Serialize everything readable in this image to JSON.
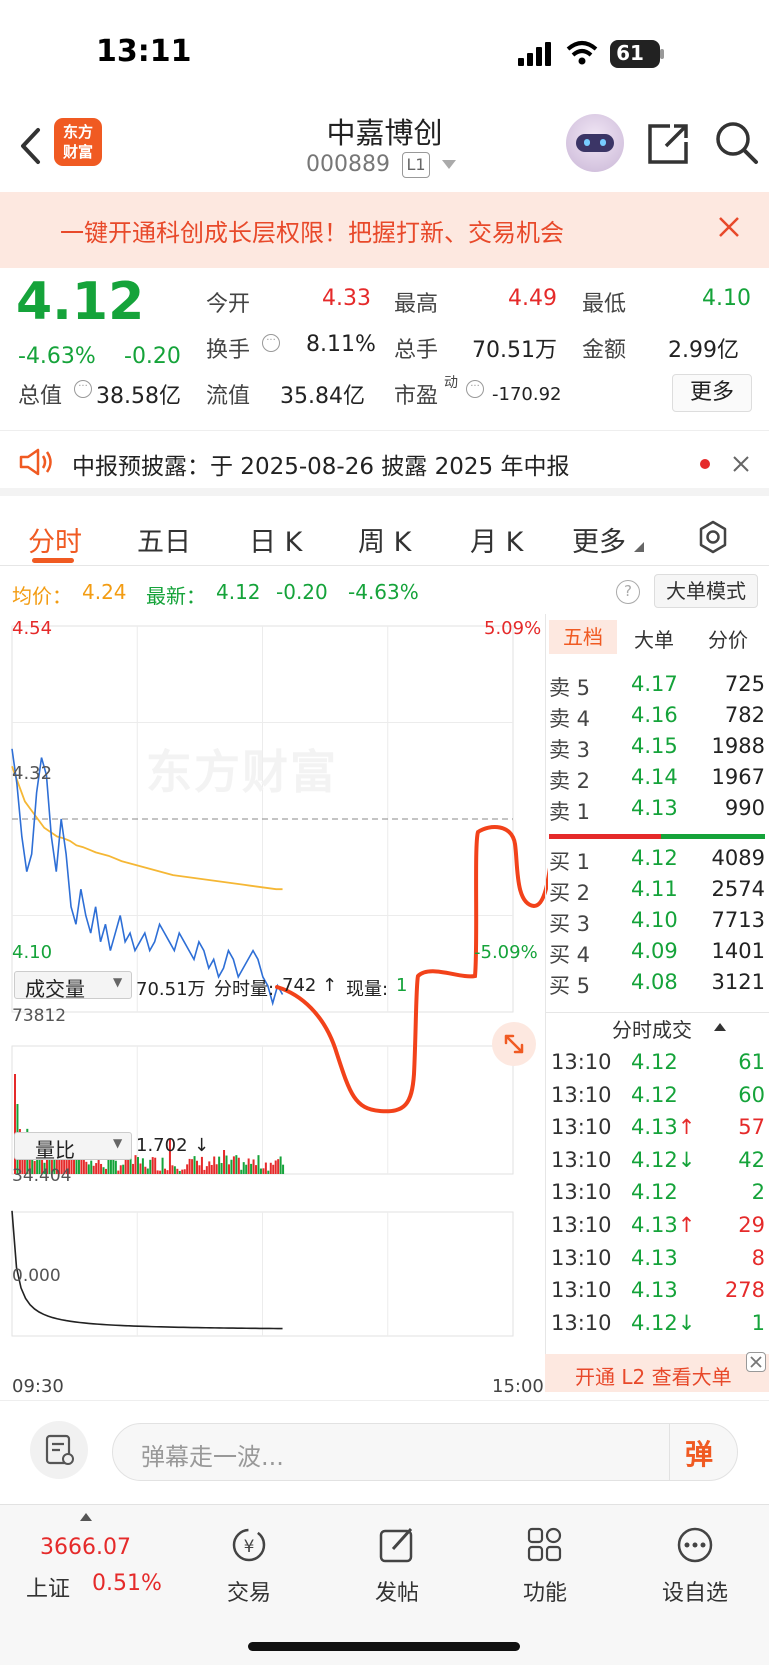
{
  "status": {
    "time": "13:11",
    "battery": "61"
  },
  "nav": {
    "logo_line1": "东方",
    "logo_line2": "财富",
    "title": "中嘉博创",
    "code": "000889",
    "level": "L1"
  },
  "banner": {
    "text": "一键开通科创成长层权限！把握打新、交易机会"
  },
  "quote": {
    "price": "4.12",
    "change_pct": "-4.63%",
    "change": "-0.20",
    "open_label": "今开",
    "open": "4.33",
    "high_label": "最高",
    "high": "4.49",
    "low_label": "最低",
    "low": "4.10",
    "turnover_label": "换手",
    "turnover": "8.11%",
    "volume_label": "总手",
    "volume": "70.51万",
    "amount_label": "金额",
    "amount": "2.99亿",
    "mktcap_label": "总值",
    "mktcap": "38.58亿",
    "float_label": "流值",
    "float": "35.84亿",
    "pe_label": "市盈",
    "pe_sup": "动",
    "pe": "-170.92",
    "more": "更多"
  },
  "notice": {
    "text": "中报预披露：于 2025-08-26 披露 2025 年中报"
  },
  "tabs": [
    "分时",
    "五日",
    "日 K",
    "周 K",
    "月 K",
    "更多"
  ],
  "chart_header": {
    "avg_label": "均价：",
    "avg": "4.24",
    "latest_label": "最新：",
    "latest": "4.12",
    "chg": "-0.20",
    "pct": "-4.63%",
    "big_order_mode": "大单模式"
  },
  "chart_data": {
    "type": "line",
    "ylim": [
      4.1,
      4.54
    ],
    "y_top_label": "4.54",
    "y_bottom_label": "4.10",
    "y_mid_label": "4.32",
    "pct_top": "5.09%",
    "pct_bottom": "-5.09%",
    "x_start": "09:30",
    "x_end": "15:00",
    "watermark": "东方财富",
    "price": [
      4.4,
      4.36,
      4.3,
      4.26,
      4.28,
      4.35,
      4.39,
      4.37,
      4.3,
      4.26,
      4.32,
      4.28,
      4.22,
      4.2,
      4.24,
      4.21,
      4.19,
      4.22,
      4.18,
      4.2,
      4.17,
      4.19,
      4.21,
      4.18,
      4.19,
      4.17,
      4.18,
      4.19,
      4.17,
      4.18,
      4.2,
      4.19,
      4.18,
      4.17,
      4.19,
      4.18,
      4.17,
      4.16,
      4.18,
      4.17,
      4.15,
      4.16,
      4.14,
      4.15,
      4.17,
      4.16,
      4.14,
      4.15,
      4.16,
      4.17,
      4.16,
      4.14,
      4.13,
      4.11,
      4.13,
      4.12
    ],
    "avg": [
      4.38,
      4.36,
      4.34,
      4.33,
      4.32,
      4.31,
      4.305,
      4.3,
      4.298,
      4.295,
      4.29,
      4.288,
      4.285,
      4.282,
      4.28,
      4.278,
      4.275,
      4.272,
      4.27,
      4.268,
      4.266,
      4.264,
      4.262,
      4.26,
      4.258,
      4.256,
      4.255,
      4.254,
      4.253,
      4.252,
      4.251,
      4.25,
      4.249,
      4.248,
      4.247,
      4.246,
      4.245,
      4.244,
      4.243,
      4.242,
      4.241,
      4.24,
      4.24
    ],
    "volume_label": "成交量",
    "volume_total": "70.51万",
    "volume_last_label": "分时量:",
    "volume_last": "742",
    "current_label": "现量:",
    "current": "1",
    "volume_max": "73812",
    "ratio_label": "量比",
    "ratio": "1.702",
    "ratio_max": "34.404",
    "ratio_min": "0.000"
  },
  "orderbook": {
    "tabs": [
      "五档",
      "大单",
      "分价"
    ],
    "asks": [
      {
        "label": "卖 5",
        "price": "4.17",
        "vol": "725"
      },
      {
        "label": "卖 4",
        "price": "4.16",
        "vol": "782"
      },
      {
        "label": "卖 3",
        "price": "4.15",
        "vol": "1988"
      },
      {
        "label": "卖 2",
        "price": "4.14",
        "vol": "1967"
      },
      {
        "label": "卖 1",
        "price": "4.13",
        "vol": "990"
      }
    ],
    "bids": [
      {
        "label": "买 1",
        "price": "4.12",
        "vol": "4089"
      },
      {
        "label": "买 2",
        "price": "4.11",
        "vol": "2574"
      },
      {
        "label": "买 3",
        "price": "4.10",
        "vol": "7713"
      },
      {
        "label": "买 4",
        "price": "4.09",
        "vol": "1401"
      },
      {
        "label": "买 5",
        "price": "4.08",
        "vol": "3121"
      }
    ]
  },
  "trades": {
    "title": "分时成交",
    "rows": [
      {
        "time": "13:10",
        "price": "4.12",
        "vol": "61",
        "dir": ""
      },
      {
        "time": "13:10",
        "price": "4.12",
        "vol": "60",
        "dir": ""
      },
      {
        "time": "13:10",
        "price": "4.13↑",
        "vol": "57",
        "dir": "up"
      },
      {
        "time": "13:10",
        "price": "4.12↓",
        "vol": "42",
        "dir": "down"
      },
      {
        "time": "13:10",
        "price": "4.12",
        "vol": "2",
        "dir": ""
      },
      {
        "time": "13:10",
        "price": "4.13↑",
        "vol": "29",
        "dir": "up"
      },
      {
        "time": "13:10",
        "price": "4.13",
        "vol": "8",
        "dir": ""
      },
      {
        "time": "13:10",
        "price": "4.13",
        "vol": "278",
        "dir": ""
      },
      {
        "time": "13:10",
        "price": "4.12↓",
        "vol": "1",
        "dir": "down"
      }
    ],
    "l2_button": "开通 L2 查看大单"
  },
  "input": {
    "placeholder": "弹幕走一波...",
    "send": "弹"
  },
  "bottom_nav": {
    "index_value": "3666.07",
    "index_name": "上证",
    "index_pct": "0.51%",
    "items": [
      "交易",
      "发帖",
      "功能",
      "设自选"
    ]
  }
}
